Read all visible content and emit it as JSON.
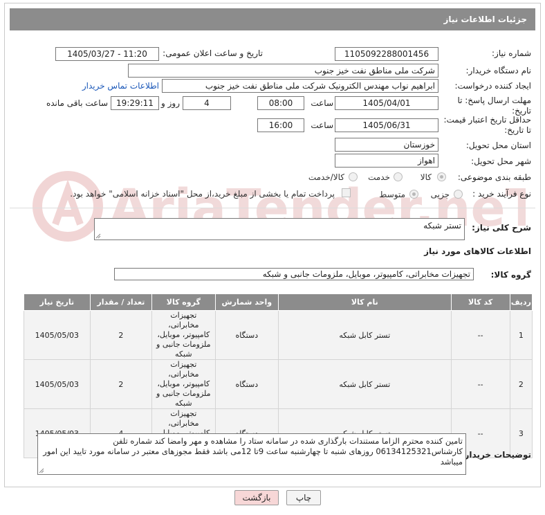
{
  "header": {
    "title": "جزئیات اطلاعات نیاز"
  },
  "fields": {
    "need_number_label": "شماره نیاز:",
    "need_number": "1105092288001456",
    "announce_label": "تاریخ و ساعت اعلان عمومی:",
    "announce_value": "1405/03/27 - 11:20",
    "buyer_org_label": "نام دستگاه خریدار:",
    "buyer_org": "شرکت ملی مناطق نفت خیز جنوب",
    "creator_label": "ایجاد کننده درخواست:",
    "creator": "ابراهیم نواب مهندس الکترونیک شرکت ملی مناطق نفت خیز جنوب",
    "contact_link": "اطلاعات تماس خریدار",
    "reply_deadline_label": "مهلت ارسال پاسخ: تا تاریخ:",
    "reply_date": "1405/04/01",
    "time_label": "ساعت",
    "reply_time": "08:00",
    "days_value": "4",
    "days_label": "روز و",
    "remaining_time": "19:29:11",
    "remaining_label": "ساعت باقی مانده",
    "price_deadline_label": "حداقل تاریخ اعتبار قیمت: تا تاریخ:",
    "price_date": "1405/06/31",
    "price_time": "16:00",
    "province_label": "استان محل تحویل:",
    "province": "خوزستان",
    "city_label": "شهر محل تحویل:",
    "city": "اهواز",
    "category_label": "طبقه بندی موضوعی:",
    "category_options": [
      "کالا",
      "خدمت",
      "کالا/خدمت"
    ],
    "process_label": "نوع فرآیند خرید :",
    "process_options": [
      "جزیی",
      "متوسط"
    ],
    "payment_note": "پرداخت تمام یا بخشی از مبلغ خرید،از محل \"اسناد خزانه اسلامی\" خواهد بود.",
    "description_label": "شرح کلی نیاز:",
    "description": "تستر شبکه",
    "goods_info_title": "اطلاعات کالاهای مورد نیاز",
    "goods_group_label": "گروه کالا:",
    "goods_group": "تجهیزات مخابراتی، کامپیوتر، موبایل، ملزومات جانبی و شبکه"
  },
  "table": {
    "headers": [
      "ردیف",
      "کد کالا",
      "نام کالا",
      "واحد شمارش",
      "گروه کالا",
      "تعداد / مقدار",
      "تاریخ نیاز"
    ],
    "rows": [
      [
        "1",
        "--",
        "تستر کابل شبکه",
        "دستگاه",
        "تجهیزات مخابراتی، کامپیوتر، موبایل، ملزومات جانبی و شبکه",
        "2",
        "1405/05/03"
      ],
      [
        "2",
        "--",
        "تستر کابل شبکه",
        "دستگاه",
        "تجهیزات مخابراتی، کامپیوتر، موبایل، ملزومات جانبی و شبکه",
        "2",
        "1405/05/03"
      ],
      [
        "3",
        "--",
        "تستر کابل شبکه",
        "دستگاه",
        "تجهیزات مخابراتی، کامپیوتر، موبایل، ملزومات جانبی و شبکه",
        "4",
        "1405/05/03"
      ]
    ]
  },
  "buyer_notes": {
    "label": "توضیحات خریدار:",
    "text": "تامین کننده محترم الزاما مستندات بارگذاری شده در سامانه ستاد را مشاهده و مهر وامضا کند شماره تلفن کارشناس06134125321 روزهای شنبه تا چهارشنبه ساعت 9تا 12می باشد فقط مجوزهای معتبر در سامانه مورد تایید این امور میباشد"
  },
  "buttons": {
    "print": "چاپ",
    "back": "بازگشت"
  },
  "watermark": {
    "text": "AriaTender.neT"
  },
  "colors": {
    "header_bg": "#8c8c8c",
    "link": "#1a57b8",
    "back_button_bg": "#f7d7d7",
    "watermark": "#f0d2d2"
  }
}
